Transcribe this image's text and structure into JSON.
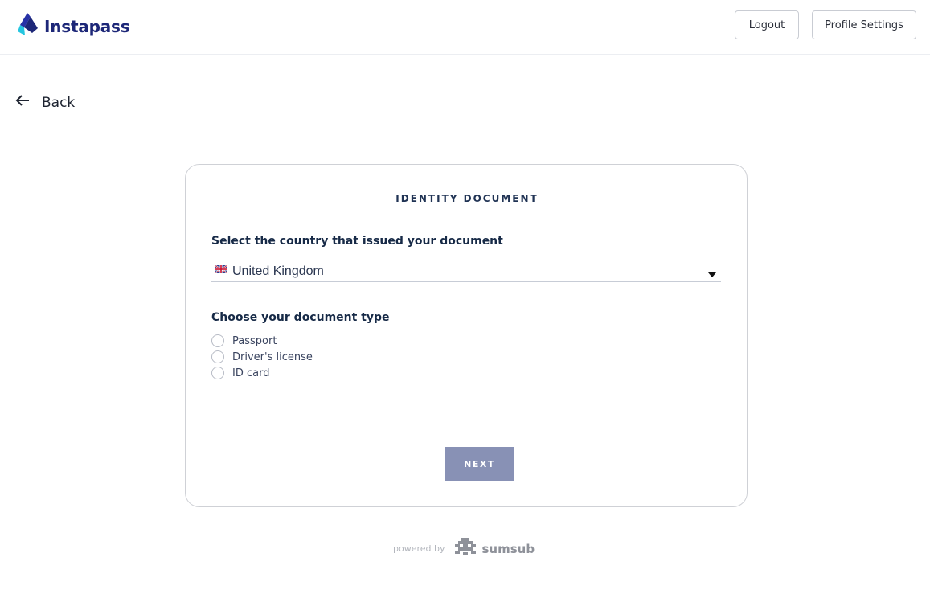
{
  "header": {
    "app_name": "Instapass",
    "logout_label": "Logout",
    "profile_settings_label": "Profile Settings"
  },
  "nav": {
    "back_label": "Back"
  },
  "card": {
    "title": "IDENTITY DOCUMENT",
    "country_label": "Select the country that issued your document",
    "country_value": "United Kingdom",
    "country_flag_icon": "uk-flag-icon",
    "doc_type_label": "Choose your document type",
    "doc_types": [
      {
        "label": "Passport",
        "selected": false
      },
      {
        "label": "Driver's license",
        "selected": false
      },
      {
        "label": "ID card",
        "selected": false
      }
    ],
    "next_label": "NEXT"
  },
  "footer": {
    "powered_by": "powered by",
    "provider": "sumsub"
  },
  "colors": {
    "brand": "#1d2778",
    "next_button": "#8891b5",
    "text_dark": "#172a47"
  }
}
